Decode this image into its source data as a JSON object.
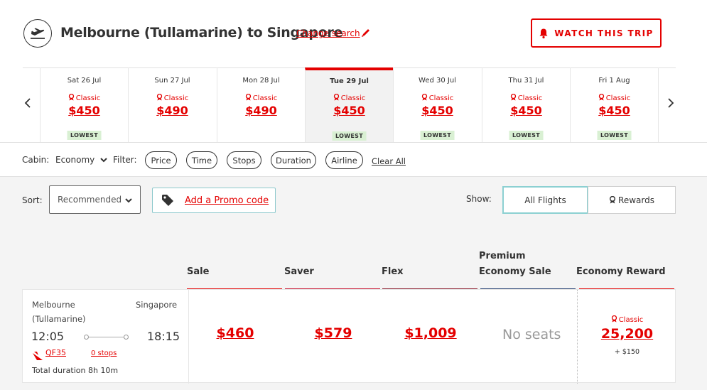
{
  "header": {
    "route_title": "Melbourne (Tullamarine) to Singapore",
    "change_search": "Change search",
    "watch_button": "WATCH THIS TRIP"
  },
  "dates": [
    {
      "label": "Sat 26 Jul",
      "fare_type": "Classic",
      "price": "$450",
      "badge": "LOWEST",
      "selected": false
    },
    {
      "label": "Sun 27 Jul",
      "fare_type": "Classic",
      "price": "$490",
      "badge": "",
      "selected": false
    },
    {
      "label": "Mon 28 Jul",
      "fare_type": "Classic",
      "price": "$490",
      "badge": "",
      "selected": false
    },
    {
      "label": "Tue 29 Jul",
      "fare_type": "Classic",
      "price": "$450",
      "badge": "LOWEST",
      "selected": true
    },
    {
      "label": "Wed 30 Jul",
      "fare_type": "Classic",
      "price": "$450",
      "badge": "LOWEST",
      "selected": false
    },
    {
      "label": "Thu 31 Jul",
      "fare_type": "Classic",
      "price": "$450",
      "badge": "LOWEST",
      "selected": false
    },
    {
      "label": "Fri 1 Aug",
      "fare_type": "Classic",
      "price": "$450",
      "badge": "LOWEST",
      "selected": false
    }
  ],
  "filters": {
    "cabin_label": "Cabin:",
    "cabin_value": "Economy",
    "filter_label": "Filter:",
    "pills": [
      "Price",
      "Time",
      "Stops",
      "Duration",
      "Airline"
    ],
    "clear_all": "Clear All"
  },
  "controls": {
    "sort_label": "Sort:",
    "sort_value": "Recommended",
    "promo": "Add a Promo code",
    "show_label": "Show:",
    "show_all": "All Flights",
    "show_rewards": "Rewards"
  },
  "columns": [
    {
      "label": "Sale",
      "color": "#e40000"
    },
    {
      "label": "Saver",
      "color": "#c8102e"
    },
    {
      "label": "Flex",
      "color": "#8b1a2b"
    },
    {
      "label": "Premium Economy Sale",
      "color": "#1f3a6e"
    },
    {
      "label": "Economy Reward",
      "color": "#e40000"
    }
  ],
  "flight": {
    "origin_line1": "Melbourne",
    "origin_line2": "(Tullamarine)",
    "destination": "Singapore",
    "depart": "12:05",
    "arrive": "18:15",
    "flight_number": "QF35",
    "stops": "0 stops",
    "duration": "Total duration 8h 10m",
    "fares": [
      "$460",
      "$579",
      "$1,009"
    ],
    "premium": "No seats",
    "reward_type": "Classic",
    "reward_points": "25,200",
    "reward_tax": "+ $150"
  },
  "colors": {
    "accent": "#e40000",
    "badge": "#d9f0d3",
    "teal": "#8cd0d2"
  }
}
